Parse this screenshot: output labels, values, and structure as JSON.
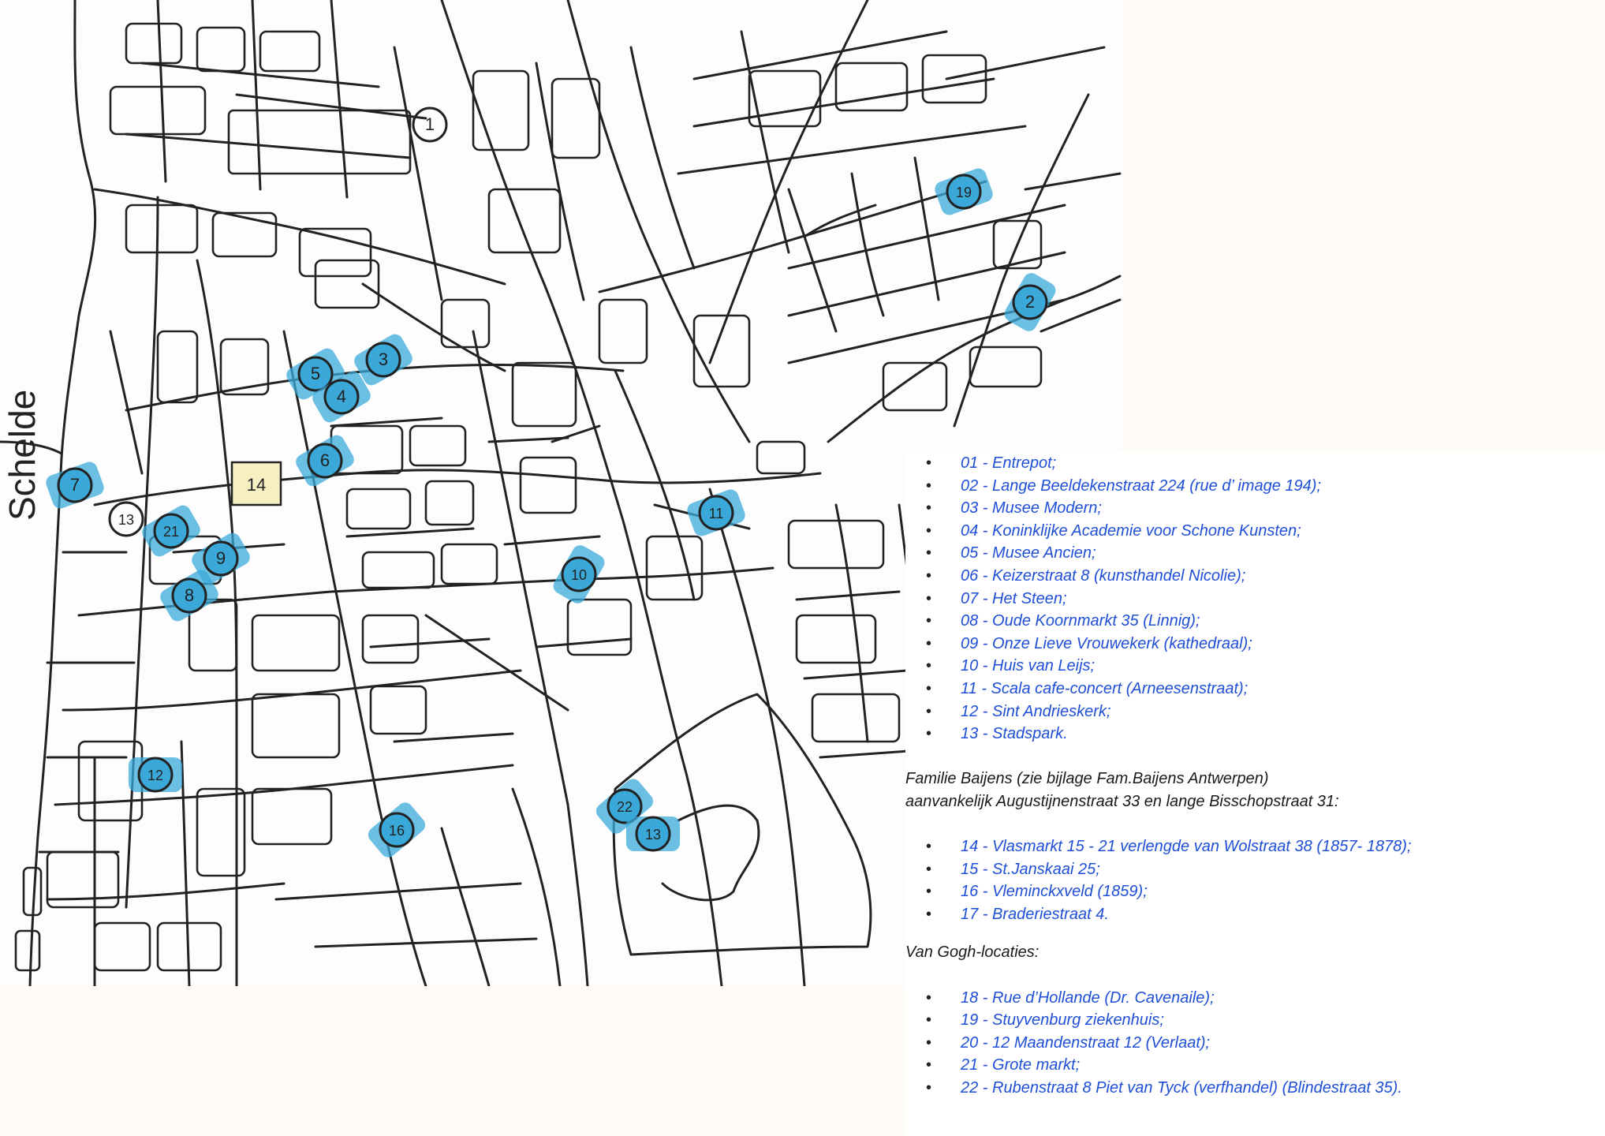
{
  "map": {
    "river_label": "Schelde",
    "markers": [
      {
        "label": "1",
        "highlight": false
      },
      {
        "label": "19",
        "highlight": true
      },
      {
        "label": "2",
        "highlight": true
      },
      {
        "label": "3",
        "highlight": true
      },
      {
        "label": "5",
        "highlight": true
      },
      {
        "label": "4",
        "highlight": true
      },
      {
        "label": "6",
        "highlight": true
      },
      {
        "label": "7",
        "highlight": true
      },
      {
        "label": "13",
        "highlight": false
      },
      {
        "label": "21",
        "highlight": true
      },
      {
        "label": "9",
        "highlight": true
      },
      {
        "label": "8",
        "highlight": true
      },
      {
        "label": "11",
        "highlight": true
      },
      {
        "label": "10",
        "highlight": true
      },
      {
        "label": "12",
        "highlight": true
      },
      {
        "label": "16",
        "highlight": true
      },
      {
        "label": "22",
        "highlight": true
      },
      {
        "label": "13",
        "highlight": true
      }
    ],
    "square_marker": "14",
    "colors": {
      "ink": "#222222",
      "highlight": "#3aa9d9",
      "square_fill": "#f5efc2"
    }
  },
  "legend": {
    "locations": [
      "01 - Entrepot;",
      "02 - Lange Beeldekenstraat 224 (rue d’ image 194);",
      "03 - Musee Modern;",
      "04 - Koninklijke Academie voor Schone Kunsten;",
      "05 -  Musee Ancien;",
      "06 -  Keizerstraat 8 (kunsthandel Nicolie);",
      "07 -  Het Steen;",
      "08 -  Oude Koornmarkt 35 (Linnig);",
      "09 -  Onze Lieve Vrouwekerk (kathedraal);",
      "10 -  Huis van Leijs;",
      "11 -  Scala cafe-concert (Arneesenstraat);",
      "12 -  Sint Andrieskerk;",
      "13 -  Stadspark."
    ],
    "family_heading_line1": "Familie Baijens (zie bijlage Fam.Baijens Antwerpen)",
    "family_heading_line2": "aanvankelijk Augustijnenstraat 33 en lange Bisschopstraat 31:",
    "family_items": [
      "14 - Vlasmarkt 15 - 21 verlengde van Wolstraat 38 (1857- 1878);",
      "15 - St.Janskaai 25;",
      "16 - Vleminckxveld (1859);",
      "17 - Braderiestraat 4."
    ],
    "vangogh_heading": "Van Gogh-locaties:",
    "vangogh_items": [
      "18 - Rue d’Hollande (Dr. Cavenaile);",
      "19 - Stuyvenburg ziekenhuis;",
      "20 - 12 Maandenstraat 12 (Verlaat);",
      "21 - Grote markt;",
      "22 - Rubenstraat 8 Piet van Tyck (verfhandel) (Blindestraat 35)."
    ],
    "colors": {
      "item_text": "#1f4fd6",
      "heading_text": "#1a1a1a"
    }
  }
}
